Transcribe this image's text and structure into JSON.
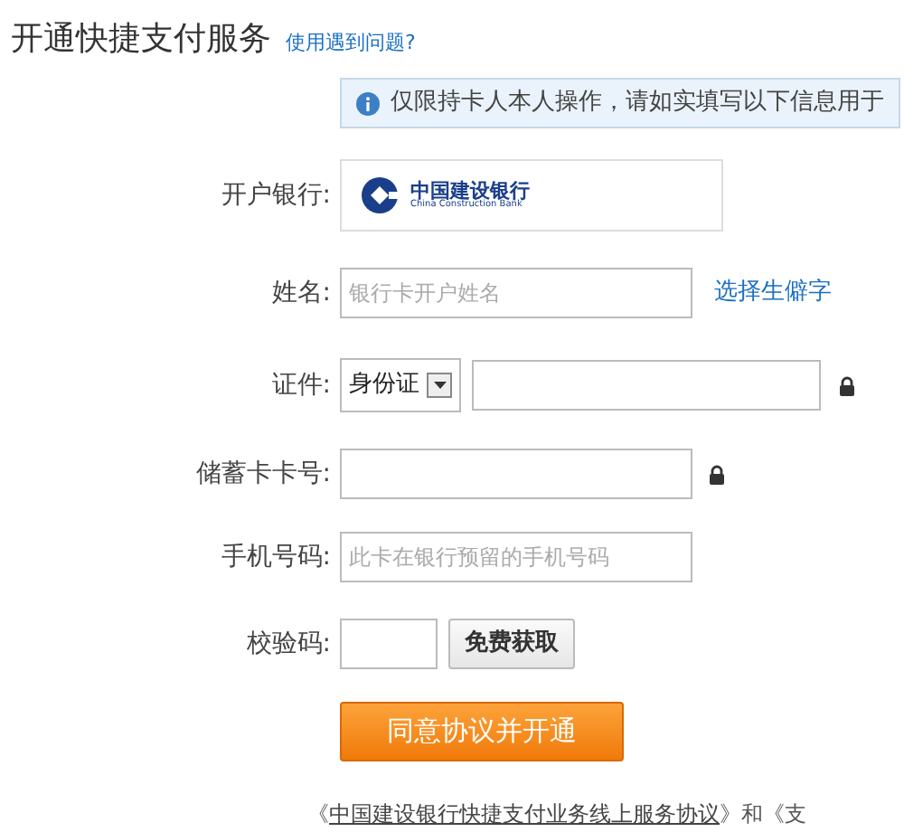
{
  "title": "开通快捷支付服务",
  "help_link": "使用遇到问题?",
  "notice": "仅限持卡人本人操作，请如实填写以下信息用于",
  "bank": {
    "label": "开户银行:",
    "name": "中国建设银行",
    "name_en": "China Construction Bank"
  },
  "name_field": {
    "label": "姓名:",
    "placeholder": "银行卡开户姓名",
    "link": "选择生僻字"
  },
  "id_field": {
    "label": "证件:",
    "type": "身份证"
  },
  "card_field": {
    "label": "储蓄卡卡号:"
  },
  "phone_field": {
    "label": "手机号码:",
    "placeholder": "此卡在银行预留的手机号码"
  },
  "code_field": {
    "label": "校验码:",
    "button": "免费获取"
  },
  "submit": "同意协议并开通",
  "terms": {
    "before": "《",
    "link": "中国建设银行快捷支付业务线上服务协议",
    "after": "》和《支"
  }
}
